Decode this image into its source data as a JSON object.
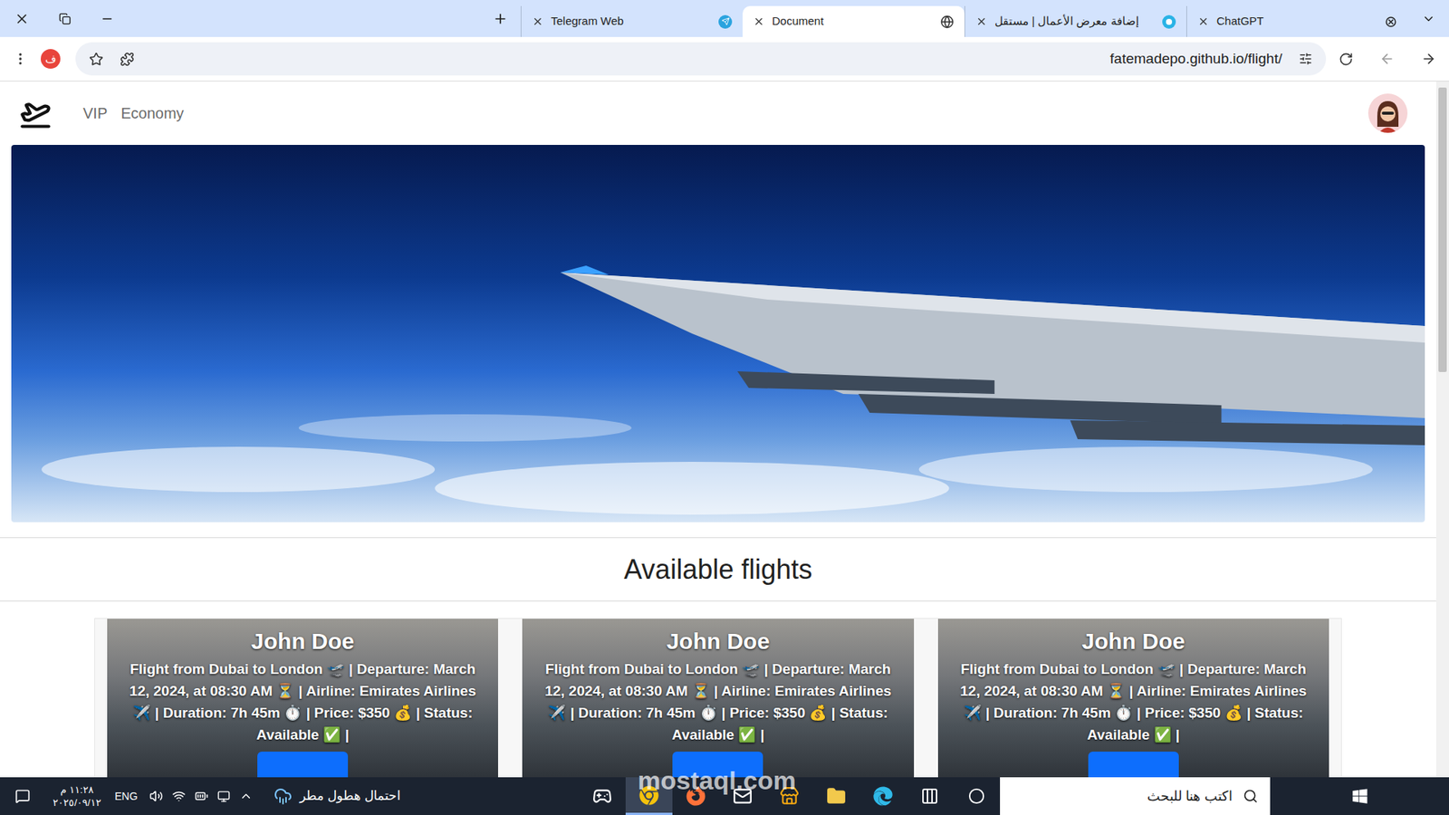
{
  "browser": {
    "tabs": [
      {
        "label": "Telegram Web",
        "selected": false,
        "icon": "telegram"
      },
      {
        "label": "Document",
        "selected": true,
        "icon": "globe"
      },
      {
        "label": "إضافة معرض الأعمال | مستقل",
        "selected": false,
        "icon": "mostaql"
      },
      {
        "label": "ChatGPT",
        "selected": false,
        "icon": "chatgpt"
      }
    ],
    "profile": "ف",
    "url": "fatemadepo.github.io/flight/"
  },
  "page": {
    "nav": [
      {
        "label": "VIP"
      },
      {
        "label": "Economy"
      }
    ],
    "heading": "Available flights",
    "cards": [
      {
        "title": "John Doe",
        "description": "Flight from Dubai to London 🛫 | Departure: March 12, 2024, at 08:30 AM ⏳ | Airline: Emirates Airlines ✈️ | Duration: 7h 45m ⏱️ | Price: $350 💰 | Status: Available ✅ |"
      },
      {
        "title": "John Doe",
        "description": "Flight from Dubai to London 🛫 | Departure: March 12, 2024, at 08:30 AM ⏳ | Airline: Emirates Airlines ✈️ | Duration: 7h 45m ⏱️ | Price: $350 💰 | Status: Available ✅ |"
      },
      {
        "title": "John Doe",
        "description": "Flight from Dubai to London 🛫 | Departure: March 12, 2024, at 08:30 AM ⏳ | Airline: Emirates Airlines ✈️ | Duration: 7h 45m ⏱️ | Price: $350 💰 | Status: Available ✅ |"
      }
    ]
  },
  "watermark": "mostaql.com",
  "taskbar": {
    "time": "١١:٢٨ م",
    "date": "٢٠٢٥/٠٩/١٢",
    "language": "ENG",
    "weather": "احتمال هطول مطر",
    "search_placeholder": "اكتب هنا للبحث",
    "apps": [
      {
        "name": "xbox",
        "selected": false
      },
      {
        "name": "chrome",
        "selected": true
      },
      {
        "name": "firefox",
        "selected": false
      },
      {
        "name": "mail",
        "selected": false
      },
      {
        "name": "store",
        "selected": false
      },
      {
        "name": "explorer",
        "selected": false
      },
      {
        "name": "edge",
        "selected": false
      },
      {
        "name": "task-view",
        "selected": false
      },
      {
        "name": "cortana",
        "selected": false
      }
    ]
  }
}
